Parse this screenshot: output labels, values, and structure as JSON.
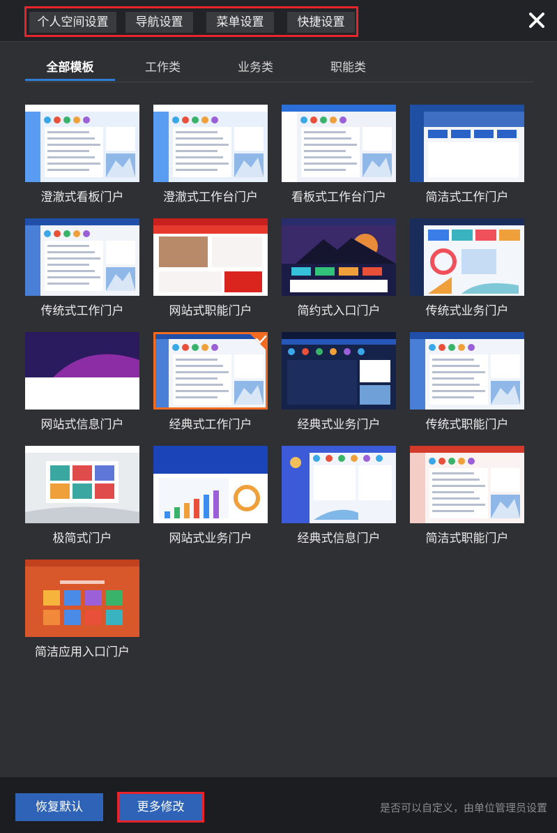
{
  "header": {
    "settings_buttons": [
      "个人空间设置",
      "导航设置",
      "菜单设置",
      "快捷设置"
    ],
    "close_icon": "close-icon"
  },
  "tabs": [
    {
      "label": "全部模板",
      "active": true
    },
    {
      "label": "工作类",
      "active": false
    },
    {
      "label": "业务类",
      "active": false
    },
    {
      "label": "职能类",
      "active": false
    }
  ],
  "templates": [
    {
      "label": "澄澈式看板门户",
      "theme": "light-blue"
    },
    {
      "label": "澄澈式工作台门户",
      "theme": "light-blue"
    },
    {
      "label": "看板式工作台门户",
      "theme": "white-blue"
    },
    {
      "label": "简洁式工作门户",
      "theme": "mountain"
    },
    {
      "label": "传统式工作门户",
      "theme": "classic-blue"
    },
    {
      "label": "网站式职能门户",
      "theme": "red-web"
    },
    {
      "label": "简约式入口门户",
      "theme": "sunset"
    },
    {
      "label": "传统式业务门户",
      "theme": "dashboard"
    },
    {
      "label": "网站式信息门户",
      "theme": "purple-wave"
    },
    {
      "label": "经典式工作门户",
      "theme": "classic-blue",
      "selected": true
    },
    {
      "label": "经典式业务门户",
      "theme": "navy"
    },
    {
      "label": "传统式职能门户",
      "theme": "classic-blue"
    },
    {
      "label": "极简式门户",
      "theme": "minimal"
    },
    {
      "label": "网站式业务门户",
      "theme": "blue-web"
    },
    {
      "label": "经典式信息门户",
      "theme": "info-blue"
    },
    {
      "label": "简洁式职能门户",
      "theme": "red-light"
    },
    {
      "label": "简洁应用入口门户",
      "theme": "orange-apps"
    }
  ],
  "footer": {
    "restore_label": "恢复默认",
    "more_label": "更多修改",
    "hint": "是否可以自定义，由单位管理员设置"
  },
  "colors": {
    "accent": "#2e63b8",
    "highlight_border": "#e8232a",
    "selected_border": "#f26b21",
    "background": "#2f3033"
  }
}
